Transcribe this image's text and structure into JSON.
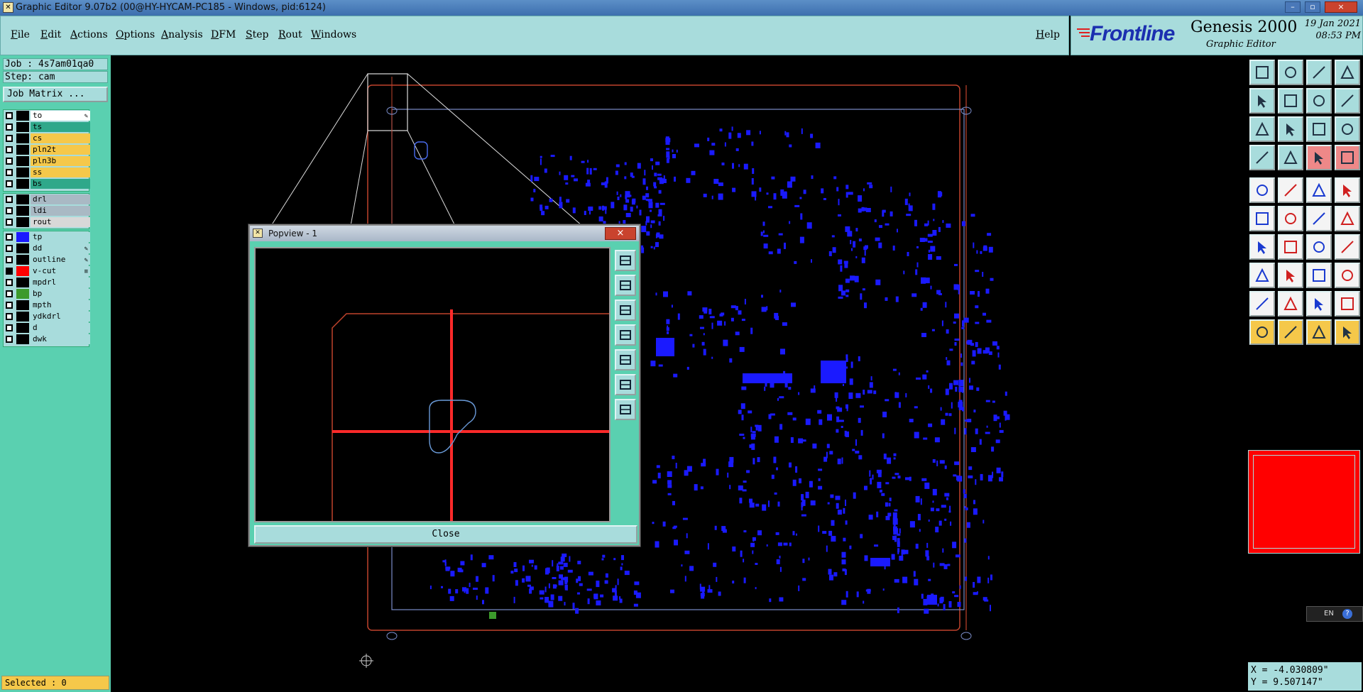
{
  "window": {
    "title": "Graphic Editor 9.07b2 (00@HY-HYCAM-PC185 - Windows, pid:6124)",
    "min_label": "–",
    "max_label": "▫",
    "close_label": "×"
  },
  "menu": {
    "items": [
      "File",
      "Edit",
      "Actions",
      "Options",
      "Analysis",
      "DFM",
      "Step",
      "Rout",
      "Windows"
    ],
    "help": "Help"
  },
  "brand": {
    "logo": "Frontline",
    "product": "Genesis 2000",
    "subtitle": "Graphic Editor",
    "date": "19 Jan 2021",
    "time": "08:53 PM"
  },
  "job": {
    "job_line": "Job : 4s7am01qa0",
    "step_line": "Step: cam",
    "matrix_button": "Job Matrix ..."
  },
  "layers": {
    "board": [
      {
        "name": "to",
        "bg": "#ffffff",
        "pen": true
      },
      {
        "name": "ts",
        "bg": "#2fa88a"
      },
      {
        "name": "cs",
        "bg": "#f5c84a"
      },
      {
        "name": "pln2t",
        "bg": "#f5c84a"
      },
      {
        "name": "pln3b",
        "bg": "#f5c84a"
      },
      {
        "name": "ss",
        "bg": "#f5c84a"
      },
      {
        "name": "bs",
        "bg": "#2fa88a"
      }
    ],
    "drill": [
      {
        "name": "drl",
        "bg": "#a9b9c4"
      },
      {
        "name": "ldi",
        "bg": "#a9b9c4"
      },
      {
        "name": "rout",
        "bg": "#d8d8d8"
      }
    ],
    "misc": [
      {
        "name": "tp",
        "bg": "#a8dcdc",
        "swatch": "#1a1aff"
      },
      {
        "name": "dd",
        "bg": "#a8dcdc",
        "pen": true
      },
      {
        "name": "outline",
        "bg": "#a8dcdc",
        "pen": true
      },
      {
        "name": "v-cut",
        "bg": "#a8dcdc",
        "swatch": "#ff0000",
        "checked": true,
        "mark": "≡"
      },
      {
        "name": "mpdrl",
        "bg": "#a8dcdc"
      },
      {
        "name": "bp",
        "bg": "#a8dcdc",
        "swatch": "#3c9a2c"
      },
      {
        "name": "mpth",
        "bg": "#a8dcdc"
      },
      {
        "name": "ydkdrl",
        "bg": "#a8dcdc"
      },
      {
        "name": "d",
        "bg": "#a8dcdc"
      },
      {
        "name": "dwk",
        "bg": "#a8dcdc"
      }
    ]
  },
  "status": {
    "selected": "Selected : 0"
  },
  "popview": {
    "title": "Popview - 1",
    "close_x": "×",
    "close_button": "Close"
  },
  "coords": {
    "x_line": "X = -4.030809\"",
    "y_line": "Y = 9.507147\""
  },
  "langbar": {
    "label": "EN"
  },
  "colors": {
    "panel": "#a8dcdc",
    "accent": "#5ad0b0",
    "layer_blue": "#1a1aff",
    "outline_red": "#ff2a2a"
  }
}
